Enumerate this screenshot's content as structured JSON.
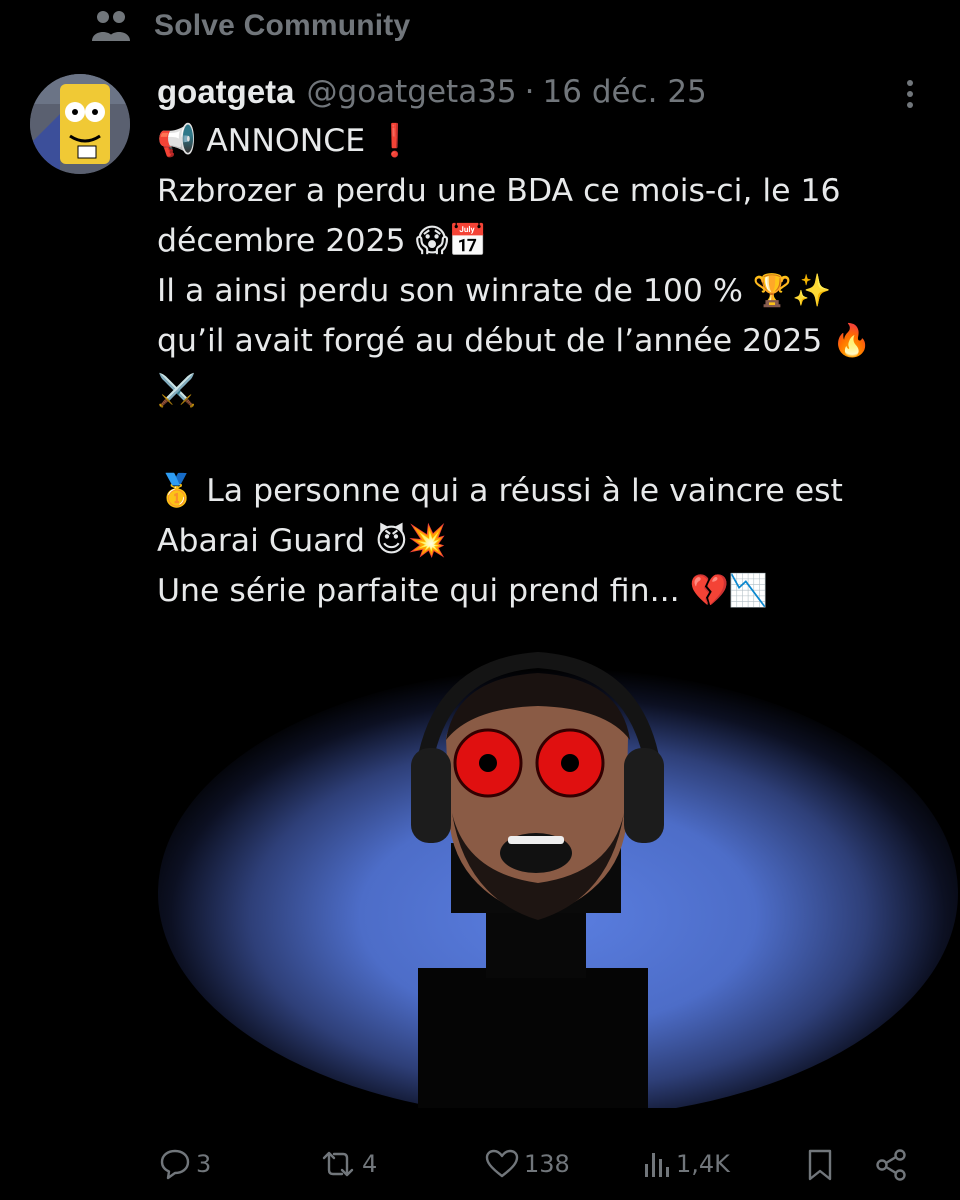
{
  "community": {
    "icon": "people-icon",
    "name": "Solve Community"
  },
  "tweet": {
    "avatar_icon": "avatar",
    "display_name": "goatgeta",
    "handle": "@goatgeta35",
    "separator": "·",
    "date": "16 déc. 25",
    "more_icon": "more-icon",
    "lines": [
      "📢 ANNONCE ❗",
      "Rzbrozer a perdu une BDA ce mois-ci, le 16",
      "décembre 2025 😱📅",
      "Il a ainsi perdu son winrate de 100 % 🏆✨",
      "qu’il avait forgé au début de l’année 2025 🔥",
      "⚔️",
      "",
      "🥇 La personne qui a réussi à le vaincre est",
      "Abarai Guard 😈💥",
      "Une série parfaite qui prend fin... 💔📉"
    ]
  },
  "actions": {
    "reply_count": "3",
    "retweet_count": "4",
    "like_count": "138",
    "views_count": "1,4K"
  },
  "colors": {
    "background": "#000000",
    "text": "#e7e9ea",
    "muted": "#71767b",
    "spotlight": "#4f6fcf",
    "eyes": "#e01010"
  }
}
